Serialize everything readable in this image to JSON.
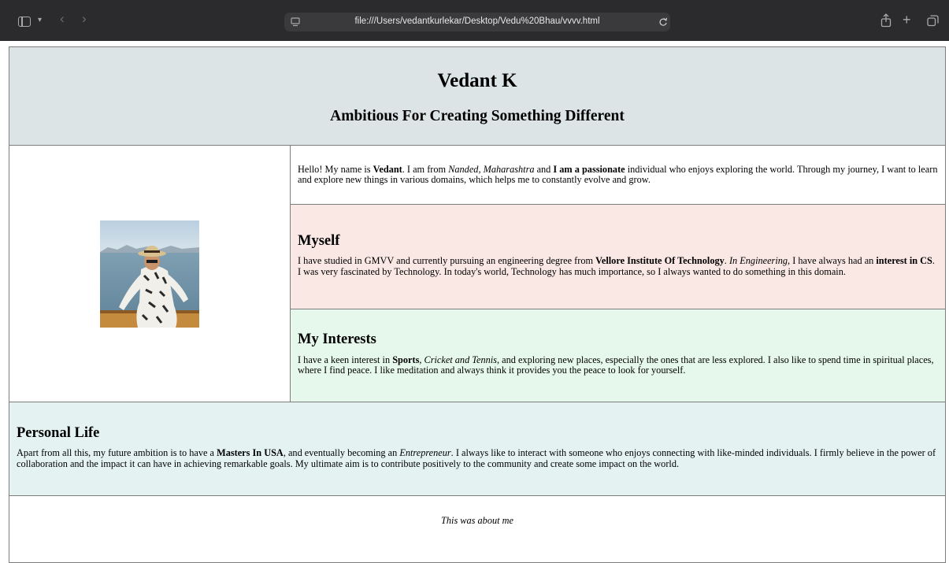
{
  "browser": {
    "url": "file:///Users/vedantkurlekar/Desktop/Vedu%20Bhau/vvvv.html"
  },
  "header": {
    "name": "Vedant K",
    "tagline": "Ambitious For Creating Something Different"
  },
  "intro": {
    "t1": "Hello! My name is ",
    "b1": "Vedant",
    "t2": ". I am from ",
    "i1": "Nanded, Maharashtra",
    "t3": " and ",
    "b2": "I am a passionate",
    "t4": " individual who enjoys exploring the world. Through my journey, I want to learn and explore new things in various domains, which helps me to constantly evolve and grow."
  },
  "myself": {
    "heading": "Myself",
    "t1": "I have studied in GMVV and currently pursuing an engineering degree from ",
    "b1": "Vellore Institute Of Technology",
    "t2": ". ",
    "i1": "In Engineering",
    "t3": ", I have always had an ",
    "b2": "interest in CS",
    "t4": ". I was very fascinated by Technology. In today's world, Technology has much importance, so I always wanted to do something in this domain."
  },
  "interests": {
    "heading": "My Interests",
    "t1": "I have a keen interest in ",
    "b1": "Sports",
    "t2": ", ",
    "i1": "Cricket and Tennis",
    "t3": ", and exploring new places, especially the ones that are less explored. I also like to spend time in spiritual places, where I find peace. I like meditation and always think it provides you the peace to look for yourself."
  },
  "personal": {
    "heading": "Personal Life",
    "t1": "Apart from all this, my future ambition is to have a ",
    "b1": "Masters In USA",
    "t2": ", and eventually becoming an ",
    "i1": "Entrepreneur",
    "t3": ". I always like to interact with someone who enjoys connecting with like-minded individuals. I firmly believe in the power of collaboration and the impact it can have in achieving remarkable goals. My ultimate aim is to contribute positively to the community and create some impact on the world."
  },
  "footer": {
    "text": "This was about me"
  },
  "colors": {
    "header_bg": "#dde4e6",
    "myself_bg": "#f9e8e4",
    "interests_bg": "#e6f8ec",
    "personal_bg": "#e4f3f2",
    "chrome_bg": "#2b2b2d"
  },
  "icons": {
    "sidebar": "sidebar-icon",
    "back": "chevron-left-icon",
    "forward": "chevron-right-icon",
    "site": "page-icon",
    "reload": "reload-icon",
    "share": "share-icon",
    "new_tab": "plus-icon",
    "tabs": "tab-overview-icon"
  }
}
